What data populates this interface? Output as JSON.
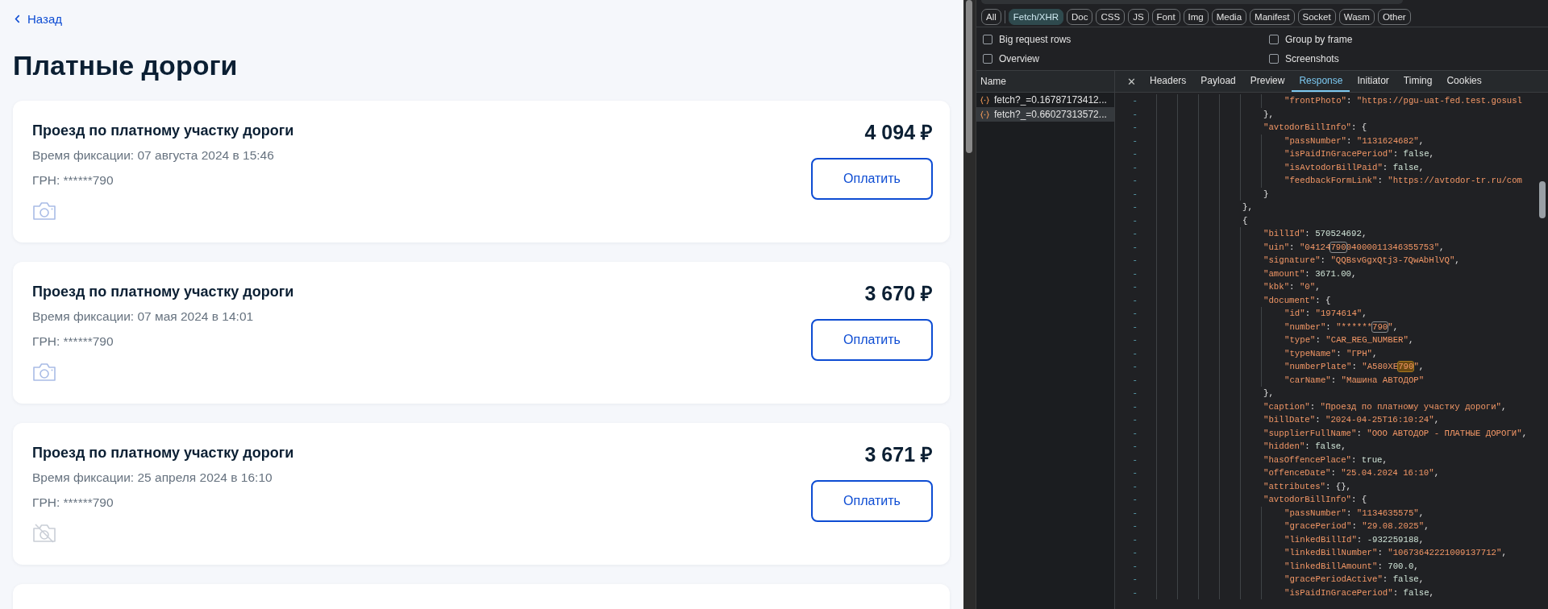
{
  "page": {
    "back_link": "Назад",
    "title": "Платные дороги",
    "bills": [
      {
        "caption": "Проезд по платному участку дороги",
        "time": "Время фиксации: 07 августа 2024 в 15:46",
        "plate": "ГРН: ******790",
        "photo_available": true,
        "amount": "4 094 ₽",
        "pay_button": "Оплатить"
      },
      {
        "caption": "Проезд по платному участку дороги",
        "time": "Время фиксации: 07 мая 2024 в 14:01",
        "plate": "ГРН: ******790",
        "photo_available": true,
        "amount": "3 670 ₽",
        "pay_button": "Оплатить"
      },
      {
        "caption": "Проезд по платному участку дороги",
        "time": "Время фиксации: 25 апреля 2024 в 16:10",
        "plate": "ГРН: ******790",
        "photo_available": false,
        "amount": "3 671 ₽",
        "pay_button": "Оплатить"
      }
    ]
  },
  "devtools": {
    "filters": [
      {
        "label": "All",
        "selected": false
      },
      {
        "label": "Fetch/XHR",
        "selected": true
      },
      {
        "label": "Doc",
        "selected": false
      },
      {
        "label": "CSS",
        "selected": false
      },
      {
        "label": "JS",
        "selected": false
      },
      {
        "label": "Font",
        "selected": false
      },
      {
        "label": "Img",
        "selected": false
      },
      {
        "label": "Media",
        "selected": false
      },
      {
        "label": "Manifest",
        "selected": false
      },
      {
        "label": "Socket",
        "selected": false
      },
      {
        "label": "Wasm",
        "selected": false
      },
      {
        "label": "Other",
        "selected": false
      }
    ],
    "options": [
      {
        "label": "Big request rows",
        "checked": false
      },
      {
        "label": "Group by frame",
        "checked": false
      },
      {
        "label": "Overview",
        "checked": false
      },
      {
        "label": "Screenshots",
        "checked": false
      }
    ],
    "name_header": "Name",
    "requests": [
      {
        "name": "fetch?_=0.16787173412...",
        "selected": false
      },
      {
        "name": "fetch?_=0.66027313572...",
        "selected": true
      }
    ],
    "close_tab": "✕",
    "tabs": [
      {
        "label": "Headers",
        "selected": false
      },
      {
        "label": "Payload",
        "selected": false
      },
      {
        "label": "Preview",
        "selected": false
      },
      {
        "label": "Response",
        "selected": true
      },
      {
        "label": "Initiator",
        "selected": false
      },
      {
        "label": "Timing",
        "selected": false
      },
      {
        "label": "Cookies",
        "selected": false
      }
    ],
    "response": [
      {
        "children": [
          {
            "children": [
              {
                "gutter": "-",
                "key": "\"frontPhoto\"",
                "sep": ": ",
                "kind": "string",
                "value": [
                  {
                    "text": "\"https://pgu-uat-fed.test.gosusl"
                  }
                ]
              }
            ]
          },
          {
            "gutter": "-",
            "end": "},"
          },
          {
            "gutter": "-",
            "key": "\"avtodorBillInfo\"",
            "sep": ": ",
            "end": "{"
          },
          {
            "children": [
              {
                "gutter": "-",
                "key": "\"passNumber\"",
                "sep": ": ",
                "kind": "string",
                "value": [
                  {
                    "text": "\"1131624682\""
                  }
                ],
                "end": ","
              },
              {
                "gutter": "-",
                "key": "\"isPaidInGracePeriod\"",
                "sep": ": ",
                "kind": "literal",
                "value": [
                  {
                    "text": "false"
                  }
                ],
                "end": ","
              },
              {
                "gutter": "-",
                "key": "\"isAvtodorBillPaid\"",
                "sep": ": ",
                "kind": "literal",
                "value": [
                  {
                    "text": "false"
                  }
                ],
                "end": ","
              },
              {
                "gutter": "-",
                "key": "\"feedbackFormLink\"",
                "sep": ": ",
                "kind": "string",
                "value": [
                  {
                    "text": "\"https://avtodor-tr.ru/com"
                  }
                ]
              }
            ]
          },
          {
            "gutter": "-",
            "end": "}"
          }
        ]
      },
      {
        "gutter": "-",
        "end": "},"
      },
      {
        "gutter": "-",
        "end": "{"
      },
      {
        "children": [
          {
            "gutter": "-",
            "key": "\"billId\"",
            "sep": ": ",
            "kind": "literal",
            "value": [
              {
                "text": "570524692"
              }
            ],
            "end": ","
          },
          {
            "gutter": "-",
            "key": "\"uin\"",
            "sep": ": ",
            "kind": "string",
            "value": [
              {
                "text": "\"04124"
              },
              {
                "text": "790",
                "current": false
              },
              {
                "text": "04000011346355753\""
              }
            ],
            "end": ","
          },
          {
            "gutter": "-",
            "key": "\"signature\"",
            "sep": ": ",
            "kind": "string",
            "value": [
              {
                "text": "\"QQBsvGgxQtj3-7QwAbHlVQ\""
              }
            ],
            "end": ","
          },
          {
            "gutter": "-",
            "key": "\"amount\"",
            "sep": ": ",
            "kind": "literal",
            "value": [
              {
                "text": "3671.00"
              }
            ],
            "end": ","
          },
          {
            "gutter": "-",
            "key": "\"kbk\"",
            "sep": ": ",
            "kind": "string",
            "value": [
              {
                "text": "\"0\""
              }
            ],
            "end": ","
          },
          {
            "gutter": "-",
            "key": "\"document\"",
            "sep": ": ",
            "end": "{"
          },
          {
            "children": [
              {
                "gutter": "-",
                "key": "\"id\"",
                "sep": ": ",
                "kind": "string",
                "value": [
                  {
                    "text": "\"1974614\""
                  }
                ],
                "end": ","
              },
              {
                "gutter": "-",
                "key": "\"number\"",
                "sep": ": ",
                "kind": "string",
                "value": [
                  {
                    "text": "\"******"
                  },
                  {
                    "text": "790",
                    "current": false
                  },
                  {
                    "text": "\""
                  }
                ],
                "end": ","
              },
              {
                "gutter": "-",
                "key": "\"type\"",
                "sep": ": ",
                "kind": "string",
                "value": [
                  {
                    "text": "\"CAR_REG_NUMBER\""
                  }
                ],
                "end": ","
              },
              {
                "gutter": "-",
                "key": "\"typeName\"",
                "sep": ": ",
                "kind": "string",
                "value": [
                  {
                    "text": "\"ГРН\""
                  }
                ],
                "end": ","
              },
              {
                "gutter": "-",
                "key": "\"numberPlate\"",
                "sep": ": ",
                "kind": "string",
                "value": [
                  {
                    "text": "\"А580ХЕ"
                  },
                  {
                    "text": "790",
                    "current": true
                  },
                  {
                    "text": "\""
                  }
                ],
                "end": ","
              },
              {
                "gutter": "-",
                "key": "\"carName\"",
                "sep": ": ",
                "kind": "string",
                "value": [
                  {
                    "text": "\"Машина АВТОДОР\""
                  }
                ]
              }
            ]
          },
          {
            "gutter": "-",
            "end": "},"
          },
          {
            "gutter": "-",
            "key": "\"caption\"",
            "sep": ": ",
            "kind": "string",
            "value": [
              {
                "text": "\"Проезд по платному участку дороги\""
              }
            ],
            "end": ","
          },
          {
            "gutter": "-",
            "key": "\"billDate\"",
            "sep": ": ",
            "kind": "string",
            "value": [
              {
                "text": "\"2024-04-25T16:10:24\""
              }
            ],
            "end": ","
          },
          {
            "gutter": "-",
            "key": "\"supplierFullName\"",
            "sep": ": ",
            "kind": "string",
            "value": [
              {
                "text": "\"ООО АВТОДОР - ПЛАТНЫЕ ДОРОГИ\""
              }
            ],
            "end": ","
          },
          {
            "gutter": "-",
            "key": "\"hidden\"",
            "sep": ": ",
            "kind": "literal",
            "value": [
              {
                "text": "false"
              }
            ],
            "end": ","
          },
          {
            "gutter": "-",
            "key": "\"hasOffencePlace\"",
            "sep": ": ",
            "kind": "literal",
            "value": [
              {
                "text": "true"
              }
            ],
            "end": ","
          },
          {
            "gutter": "-",
            "key": "\"offenceDate\"",
            "sep": ": ",
            "kind": "string",
            "value": [
              {
                "text": "\"25.04.2024 16:10\""
              }
            ],
            "end": ","
          },
          {
            "gutter": "-",
            "key": "\"attributes\"",
            "sep": ": ",
            "end": "{},"
          },
          {
            "gutter": "-",
            "key": "\"avtodorBillInfo\"",
            "sep": ": ",
            "end": "{"
          },
          {
            "children": [
              {
                "gutter": "-",
                "key": "\"passNumber\"",
                "sep": ": ",
                "kind": "string",
                "value": [
                  {
                    "text": "\"1134635575\""
                  }
                ],
                "end": ","
              },
              {
                "gutter": "-",
                "key": "\"gracePeriod\"",
                "sep": ": ",
                "kind": "string",
                "value": [
                  {
                    "text": "\"29.08.2025\""
                  }
                ],
                "end": ","
              },
              {
                "gutter": "-",
                "key": "\"linkedBillId\"",
                "sep": ": ",
                "kind": "literal",
                "value": [
                  {
                    "text": "-932259188"
                  }
                ],
                "end": ","
              },
              {
                "gutter": "-",
                "key": "\"linkedBillNumber\"",
                "sep": ": ",
                "kind": "string",
                "value": [
                  {
                    "text": "\"10673642221009137712\""
                  }
                ],
                "end": ","
              },
              {
                "gutter": "-",
                "key": "\"linkedBillAmount\"",
                "sep": ": ",
                "kind": "literal",
                "value": [
                  {
                    "text": "700.0"
                  }
                ],
                "end": ","
              },
              {
                "gutter": "-",
                "key": "\"gracePeriodActive\"",
                "sep": ": ",
                "kind": "literal",
                "value": [
                  {
                    "text": "false"
                  }
                ],
                "end": ","
              },
              {
                "gutter": "-",
                "key": "\"isPaidInGracePeriod\"",
                "sep": ": ",
                "kind": "literal",
                "value": [
                  {
                    "text": "false"
                  }
                ],
                "end": ","
              }
            ]
          }
        ]
      }
    ]
  }
}
